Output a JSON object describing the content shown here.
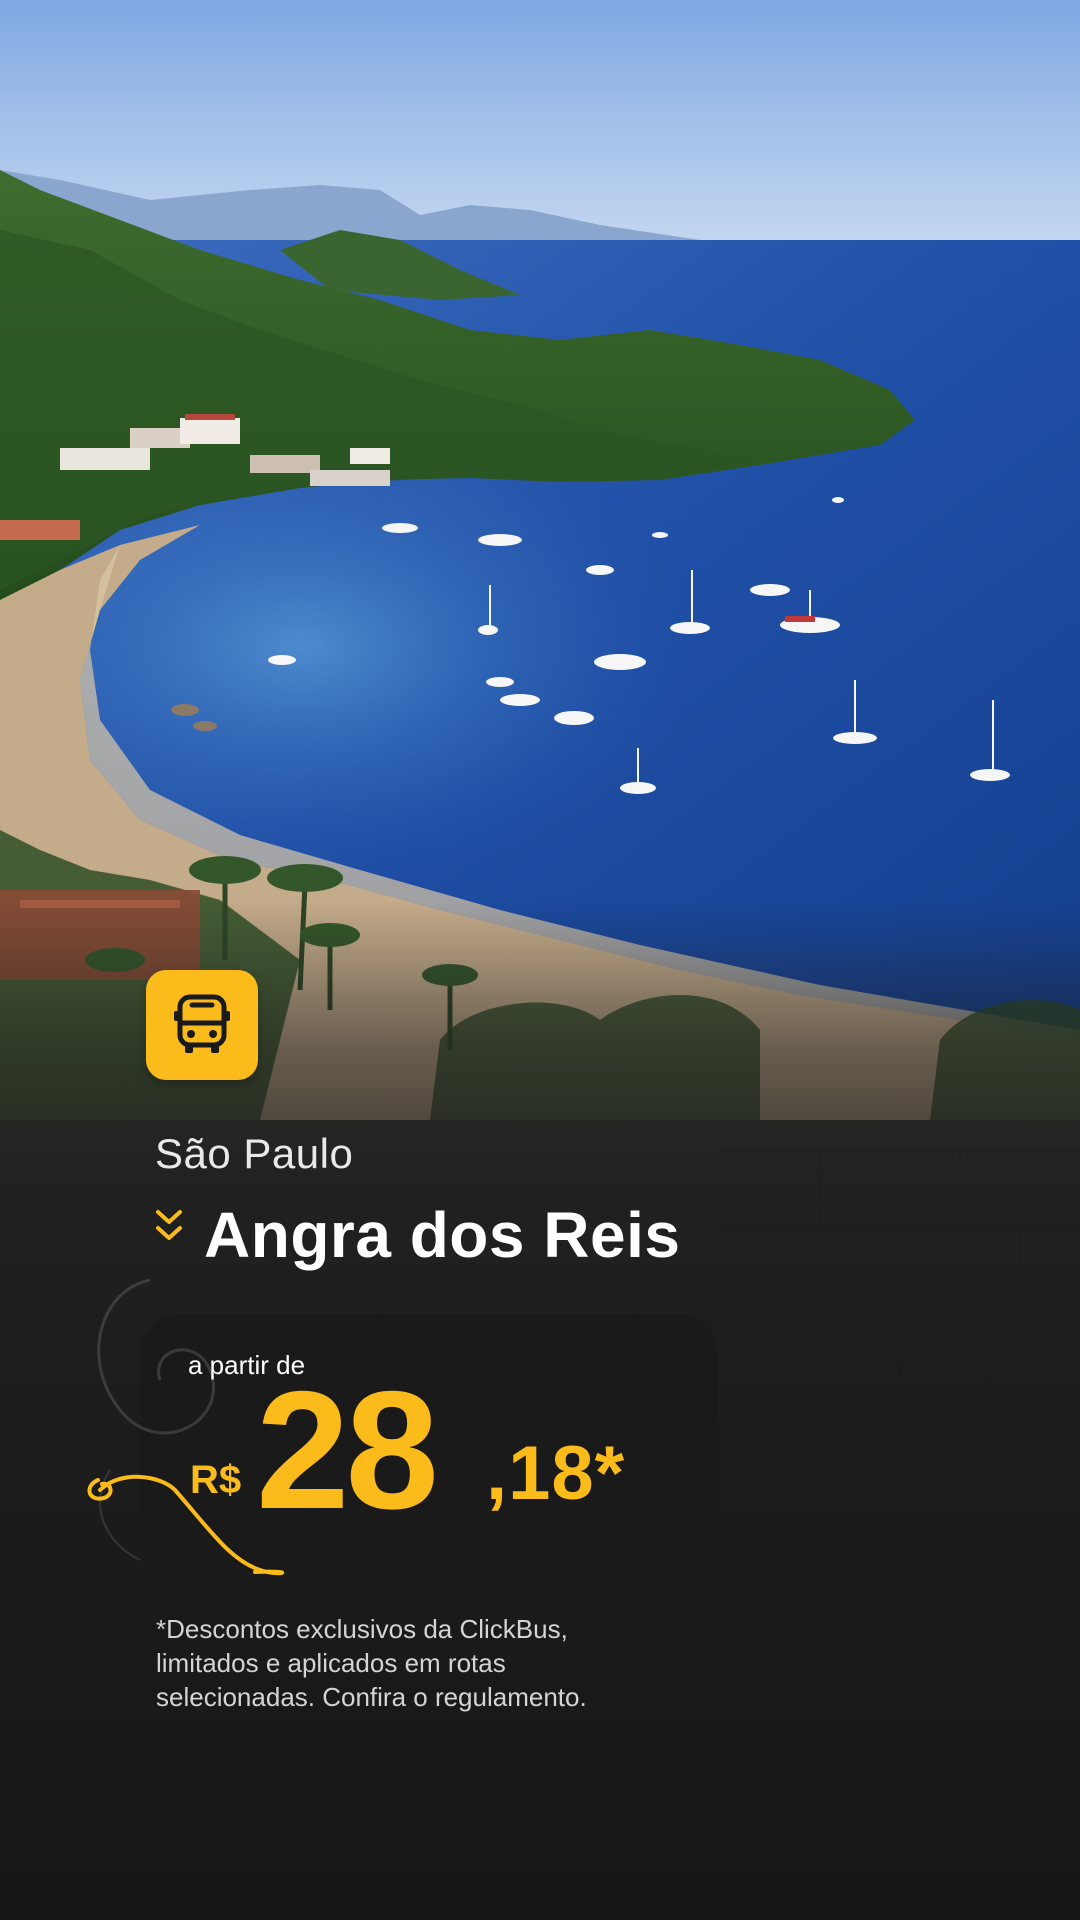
{
  "route": {
    "origin": "São Paulo",
    "destination": "Angra dos Reis"
  },
  "price": {
    "from_label": "a partir de",
    "currency": "R$",
    "integer": "28",
    "cents": ",18*"
  },
  "disclaimer": {
    "lines": [
      "*Descontos exclusivos da ClickBus,",
      "limitados e aplicados em rotas",
      "selecionadas. Confira o regulamento."
    ]
  },
  "icons": {
    "badge": "bus-icon",
    "route_arrow": "double-chevron-down-icon"
  },
  "colors": {
    "accent": "#fbbb1a",
    "dark": "#1a1a1a",
    "sea": "#1f4fa6",
    "sky": "#a8c4ec",
    "forest": "#2f5a24"
  }
}
